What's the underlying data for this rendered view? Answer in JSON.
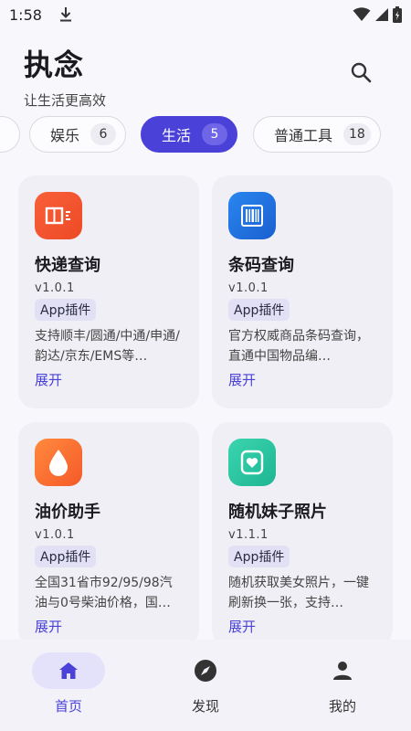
{
  "status_bar": {
    "time": "1:58"
  },
  "header": {
    "title": "执念",
    "subtitle": "让生活更高效"
  },
  "chips": [
    {
      "label": "娱乐",
      "count": "6",
      "active": false
    },
    {
      "label": "生活",
      "count": "5",
      "active": true
    },
    {
      "label": "普通工具",
      "count": "18",
      "active": false
    }
  ],
  "cards": [
    {
      "name": "快递查询",
      "version": "v1.0.1",
      "badge": "App插件",
      "desc": "支持顺丰/圆通/中通/申通/韵达/京东/EMS等…",
      "expand": "展开",
      "icon": "package-icon",
      "icon_color": "#f2502b"
    },
    {
      "name": "条码查询",
      "version": "v1.0.1",
      "badge": "App插件",
      "desc": "官方权威商品条码查询，直通中国物品编…",
      "expand": "展开",
      "icon": "barcode-icon",
      "icon_color": "#1f6fe0"
    },
    {
      "name": "油价助手",
      "version": "v1.0.1",
      "badge": "App插件",
      "desc": "全国31省市92/95/98汽油与0号柴油价格，国…",
      "expand": "展开",
      "icon": "drop-icon",
      "icon_color": "#f7672c"
    },
    {
      "name": "随机妹子照片",
      "version": "v1.1.1",
      "badge": "App插件",
      "desc": "随机获取美女照片，一键刷新换一张，支持…",
      "expand": "展开",
      "icon": "heart-photo-icon",
      "icon_color": "#2bbf9a"
    }
  ],
  "bottom_nav": [
    {
      "label": "首页",
      "icon": "home-icon",
      "active": true
    },
    {
      "label": "发现",
      "icon": "compass-icon",
      "active": false
    },
    {
      "label": "我的",
      "icon": "person-icon",
      "active": false
    }
  ],
  "colors": {
    "accent": "#4a41d8",
    "card_bg": "#efeff5",
    "page_bg": "#f8f8fc"
  }
}
